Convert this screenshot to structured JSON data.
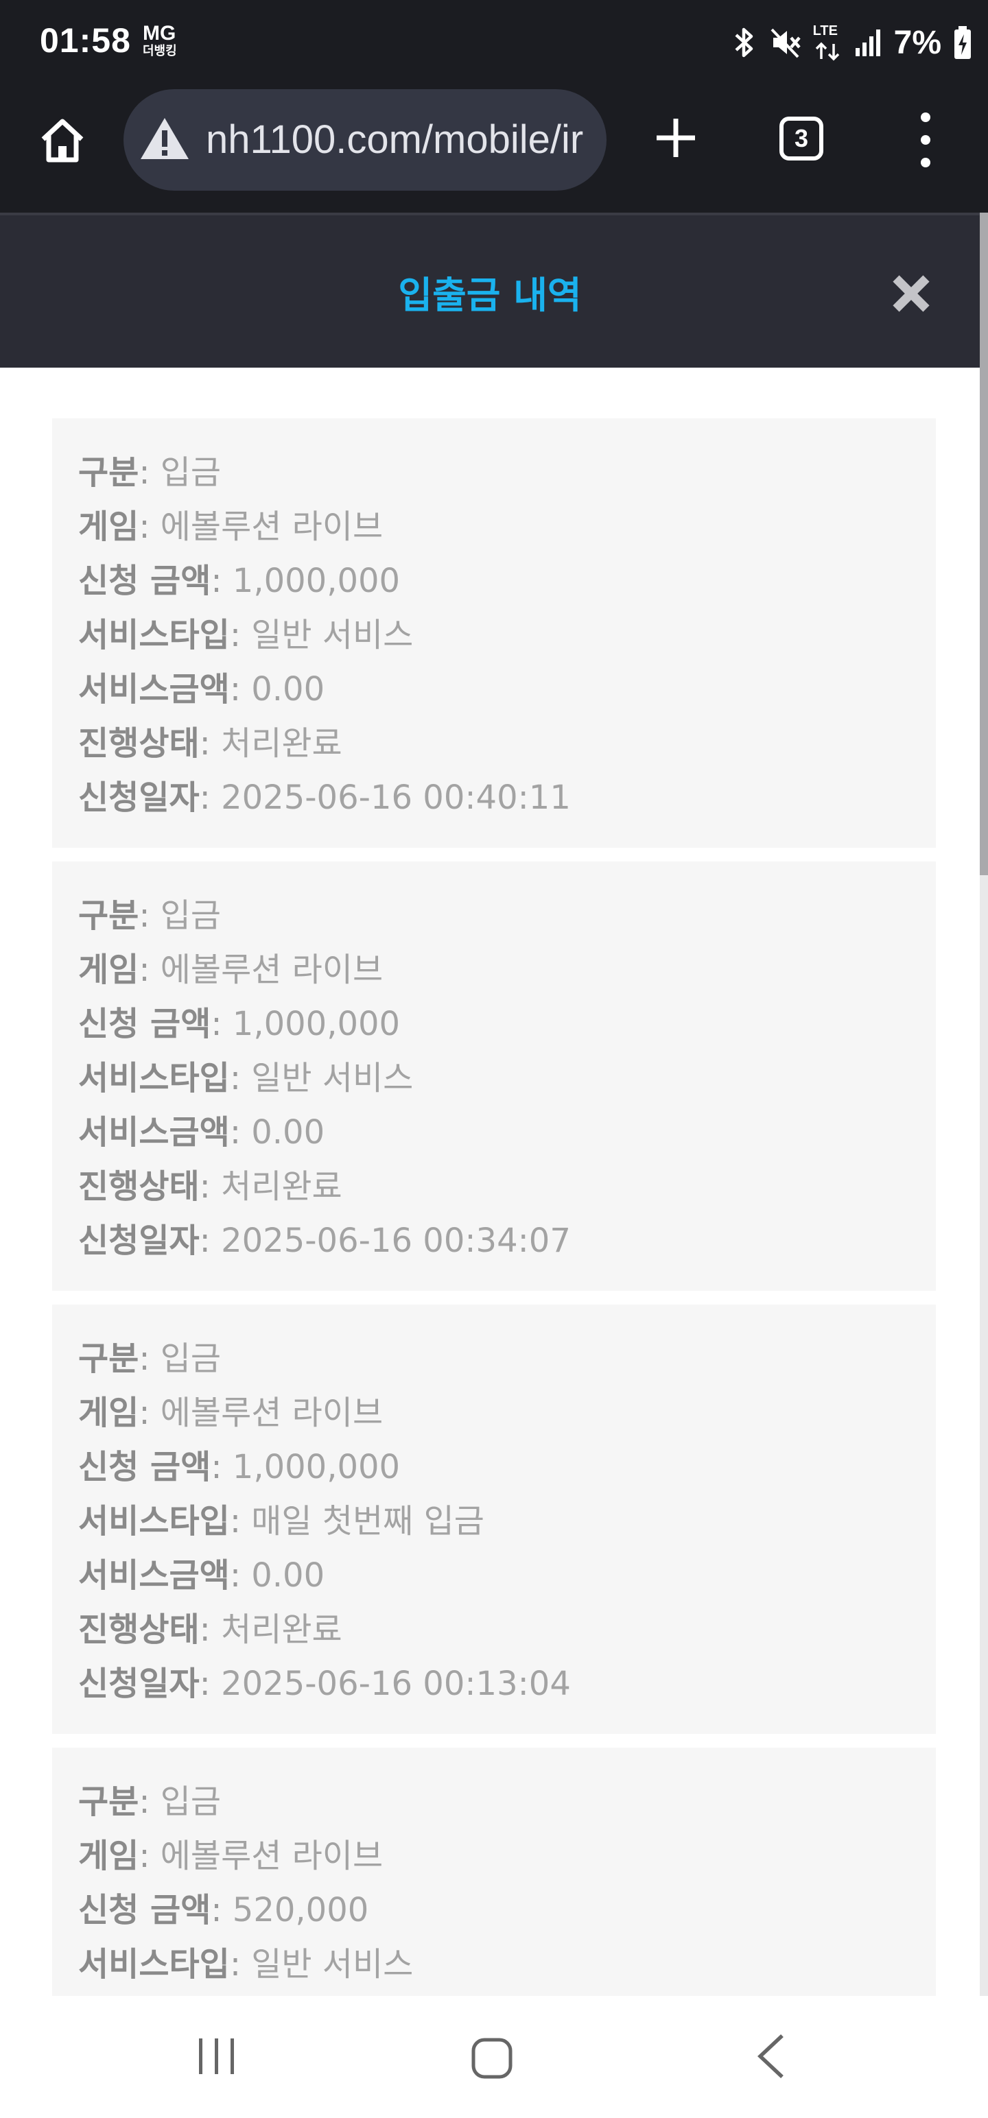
{
  "status_bar": {
    "time": "01:58",
    "carrier_top": "MG",
    "carrier_bottom": "더뱅킹",
    "network": "LTE",
    "battery": "7%"
  },
  "browser": {
    "url": "nh1100.com/mobile/ir",
    "tab_count": "3"
  },
  "header": {
    "title": "입출금 내역",
    "title_color": "#1ab2ee"
  },
  "labels": {
    "type": "구분",
    "game": "게임",
    "amount": "신청 금액",
    "service_type": "서비스타입",
    "service_amount": "서비스금액",
    "status": "진행상태",
    "date": "신청일자"
  },
  "records": [
    {
      "type": "입금",
      "game": "에볼루션 라이브",
      "amount": "1,000,000",
      "service_type": "일반 서비스",
      "service_amount": "0.00",
      "status": "처리완료",
      "date": "2025-06-16 00:40:11"
    },
    {
      "type": "입금",
      "game": "에볼루션 라이브",
      "amount": "1,000,000",
      "service_type": "일반 서비스",
      "service_amount": "0.00",
      "status": "처리완료",
      "date": "2025-06-16 00:34:07"
    },
    {
      "type": "입금",
      "game": "에볼루션 라이브",
      "amount": "1,000,000",
      "service_type": "매일 첫번째 입금",
      "service_amount": "0.00",
      "status": "처리완료",
      "date": "2025-06-16 00:13:04"
    },
    {
      "type": "입금",
      "game": "에볼루션 라이브",
      "amount": "520,000",
      "service_type": "일반 서비스"
    }
  ]
}
